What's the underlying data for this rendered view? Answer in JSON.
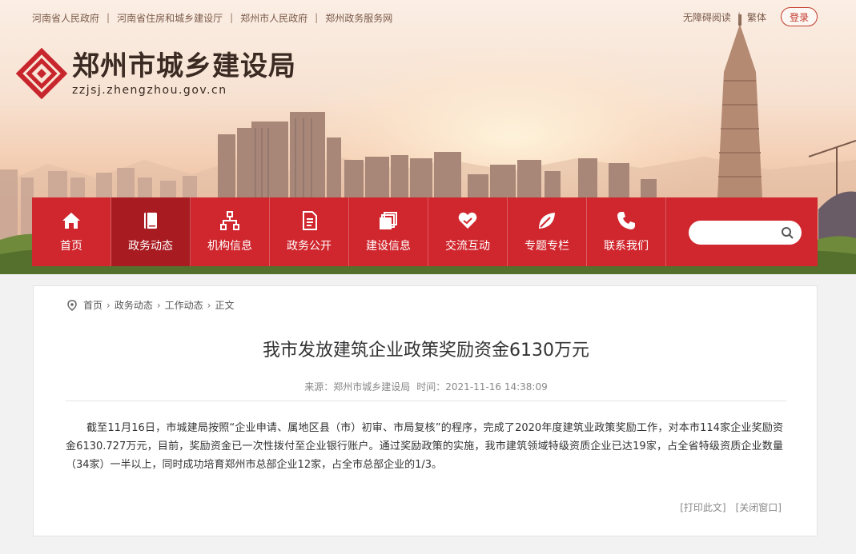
{
  "header": {
    "top_links": [
      "河南省人民政府",
      "河南省住房和城乡建设厅",
      "郑州市人民政府",
      "郑州政务服务网"
    ],
    "accessibility": "无障碍阅读",
    "traditional": "繁体",
    "login": "登录",
    "site_title": "郑州市城乡建设局",
    "site_domain": "zzjsj.zhengzhou.gov.cn"
  },
  "nav": {
    "items": [
      {
        "label": "首页",
        "icon": "home-icon"
      },
      {
        "label": "政务动态",
        "icon": "book-icon"
      },
      {
        "label": "机构信息",
        "icon": "org-chart-icon"
      },
      {
        "label": "政务公开",
        "icon": "document-icon"
      },
      {
        "label": "建设信息",
        "icon": "stack-icon"
      },
      {
        "label": "交流互动",
        "icon": "handshake-heart-icon"
      },
      {
        "label": "专题专栏",
        "icon": "leaf-icon"
      },
      {
        "label": "联系我们",
        "icon": "phone-icon"
      }
    ],
    "active_index": 1,
    "search_placeholder": ""
  },
  "breadcrumb": [
    "首页",
    "政务动态",
    "工作动态",
    "正文"
  ],
  "article": {
    "title": "我市发放建筑企业政策奖励资金6130万元",
    "source": "来源：郑州市城乡建设局",
    "time": "时间：2021-11-16 14:38:09",
    "body": "截至11月16日，市城建局按照“企业申请、属地区县（市）初审、市局复核”的程序，完成了2020年度建筑业政策奖励工作，对本市114家企业奖励资金6130.727万元，目前，奖励资金已一次性拨付至企业银行账户。通过奖励政策的实施，我市建筑领域特级资质企业已达19家，占全省特级资质企业数量（34家）一半以上，同时成功培育郑州市总部企业12家，占全市总部企业的1/3。",
    "print": "[打印此文]",
    "close": "[关闭窗口]"
  },
  "colors": {
    "nav_red": "#d0262d",
    "nav_active": "#a81b21",
    "login_border": "#c23a2d"
  }
}
